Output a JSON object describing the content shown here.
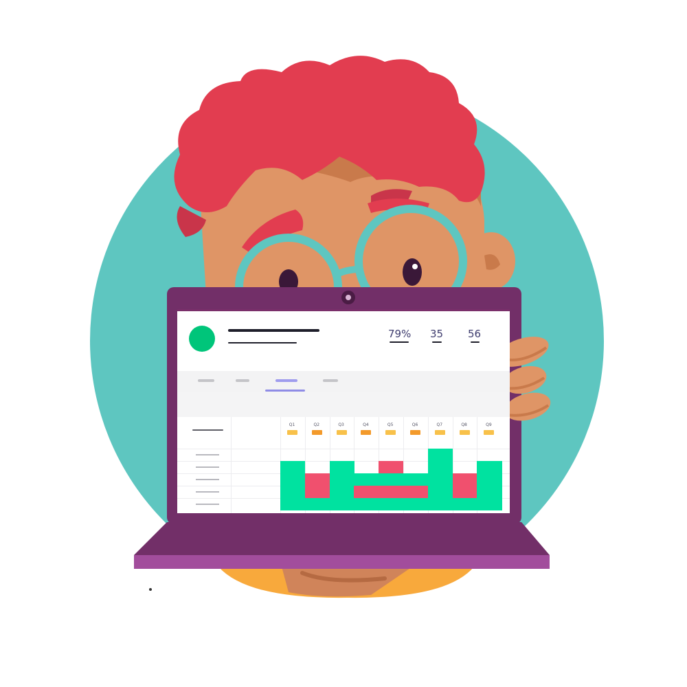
{
  "profile": {
    "stats": [
      "79%",
      "35",
      "56"
    ]
  },
  "tabs": [
    {
      "active": false
    },
    {
      "active": false
    },
    {
      "active": true
    },
    {
      "active": false
    }
  ],
  "grid": {
    "columns": [
      "Q1",
      "Q2",
      "Q3",
      "Q4",
      "Q5",
      "Q6",
      "Q7",
      "Q8",
      "Q9"
    ],
    "column_chip_colors": [
      "#f8c14a",
      "#f39a2b",
      "#f8c14a",
      "#f39a2b",
      "#f8c14a",
      "#f39a2b",
      "#f8c14a",
      "#f8c14a",
      "#f8c14a"
    ],
    "rows": [
      [
        "empty",
        "empty",
        "empty",
        "empty",
        "empty",
        "empty",
        "correct",
        "empty",
        "empty"
      ],
      [
        "correct",
        "empty",
        "correct",
        "empty",
        "wrong",
        "empty",
        "correct",
        "empty",
        "correct"
      ],
      [
        "correct",
        "wrong",
        "correct",
        "correct",
        "correct",
        "correct",
        "correct",
        "wrong",
        "correct"
      ],
      [
        "correct",
        "wrong",
        "correct",
        "wrong",
        "wrong",
        "wrong",
        "correct",
        "wrong",
        "correct"
      ],
      [
        "correct",
        "correct",
        "correct",
        "correct",
        "correct",
        "correct",
        "correct",
        "correct",
        "correct"
      ]
    ]
  },
  "colors": {
    "background_circle": "#5ec6c0",
    "hair": "#e23d50",
    "skin": "#df9566",
    "skin_shadow": "#c97a4b",
    "glasses": "#5ec6c0",
    "laptop_lid": "#722f68",
    "laptop_base": "#a24d9c",
    "shirt": "#f8a93c",
    "correct": "#00e2a0",
    "wrong": "#f0506e",
    "avatar": "#00c57a"
  }
}
